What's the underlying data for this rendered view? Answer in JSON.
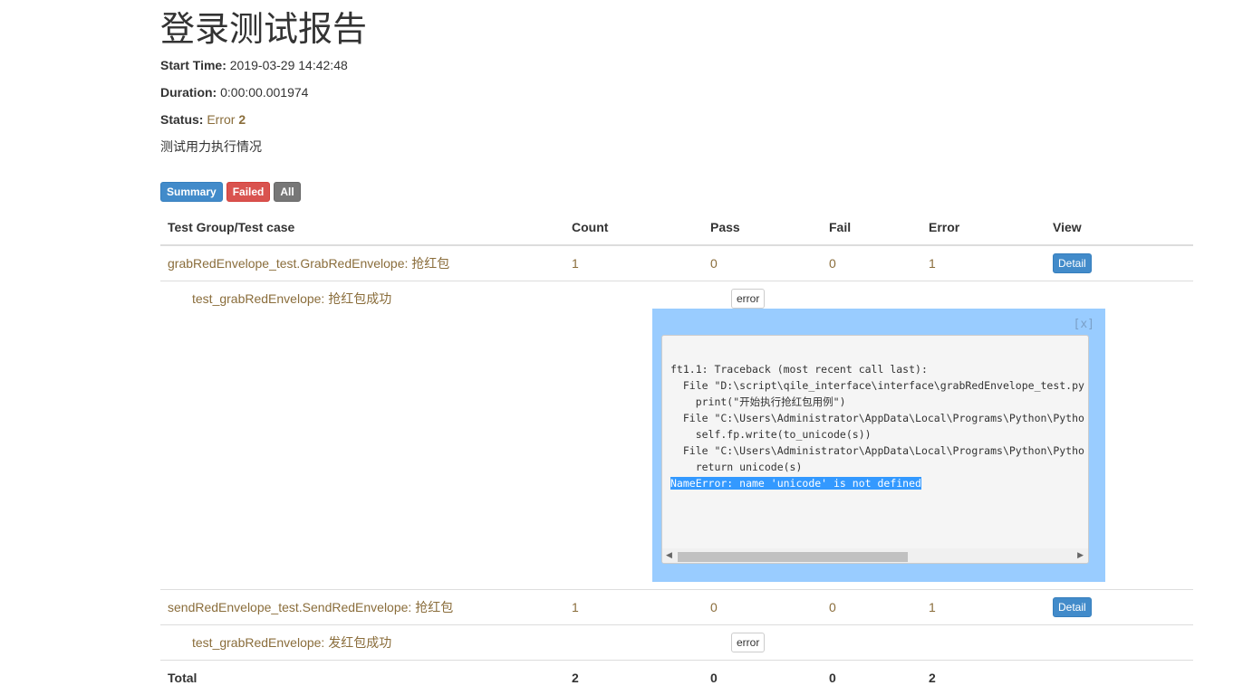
{
  "title": "登录测试报告",
  "attributes": {
    "start_time_label": "Start Time:",
    "start_time": "2019-03-29 14:42:48",
    "duration_label": "Duration:",
    "duration": "0:00:00.001974",
    "status_label": "Status:",
    "status_value": "Error",
    "status_count": "2"
  },
  "description": "测试用力执行情况",
  "filters": {
    "summary": "Summary",
    "failed": "Failed",
    "all": "All"
  },
  "table": {
    "headers": [
      "Test Group/Test case",
      "Count",
      "Pass",
      "Fail",
      "Error",
      "View"
    ],
    "groups": [
      {
        "name": "grabRedEnvelope_test.GrabRedEnvelope: 抢红包",
        "count": "1",
        "pass": "0",
        "fail": "0",
        "error": "1",
        "view": "Detail",
        "case": {
          "name": "test_grabRedEnvelope: 抢红包成功",
          "status": "error"
        }
      },
      {
        "name": "sendRedEnvelope_test.SendRedEnvelope: 抢红包",
        "count": "1",
        "pass": "0",
        "fail": "0",
        "error": "1",
        "view": "Detail",
        "case": {
          "name": "test_grabRedEnvelope: 发红包成功",
          "status": "error"
        }
      }
    ],
    "total": {
      "label": "Total",
      "count": "2",
      "pass": "0",
      "fail": "0",
      "error": "2"
    }
  },
  "popup": {
    "close": "[x]",
    "traceback": [
      "ft1.1: Traceback (most recent call last):",
      "  File \"D:\\script\\qile_interface\\interface\\grabRedEnvelope_test.py",
      "    print(\"开始执行抢红包用例\")",
      "  File \"C:\\Users\\Administrator\\AppData\\Local\\Programs\\Python\\Pytho",
      "    self.fp.write(to_unicode(s))",
      "  File \"C:\\Users\\Administrator\\AppData\\Local\\Programs\\Python\\Pytho",
      "    return unicode(s)"
    ],
    "error_line": "NameError: name 'unicode' is not defined"
  }
}
